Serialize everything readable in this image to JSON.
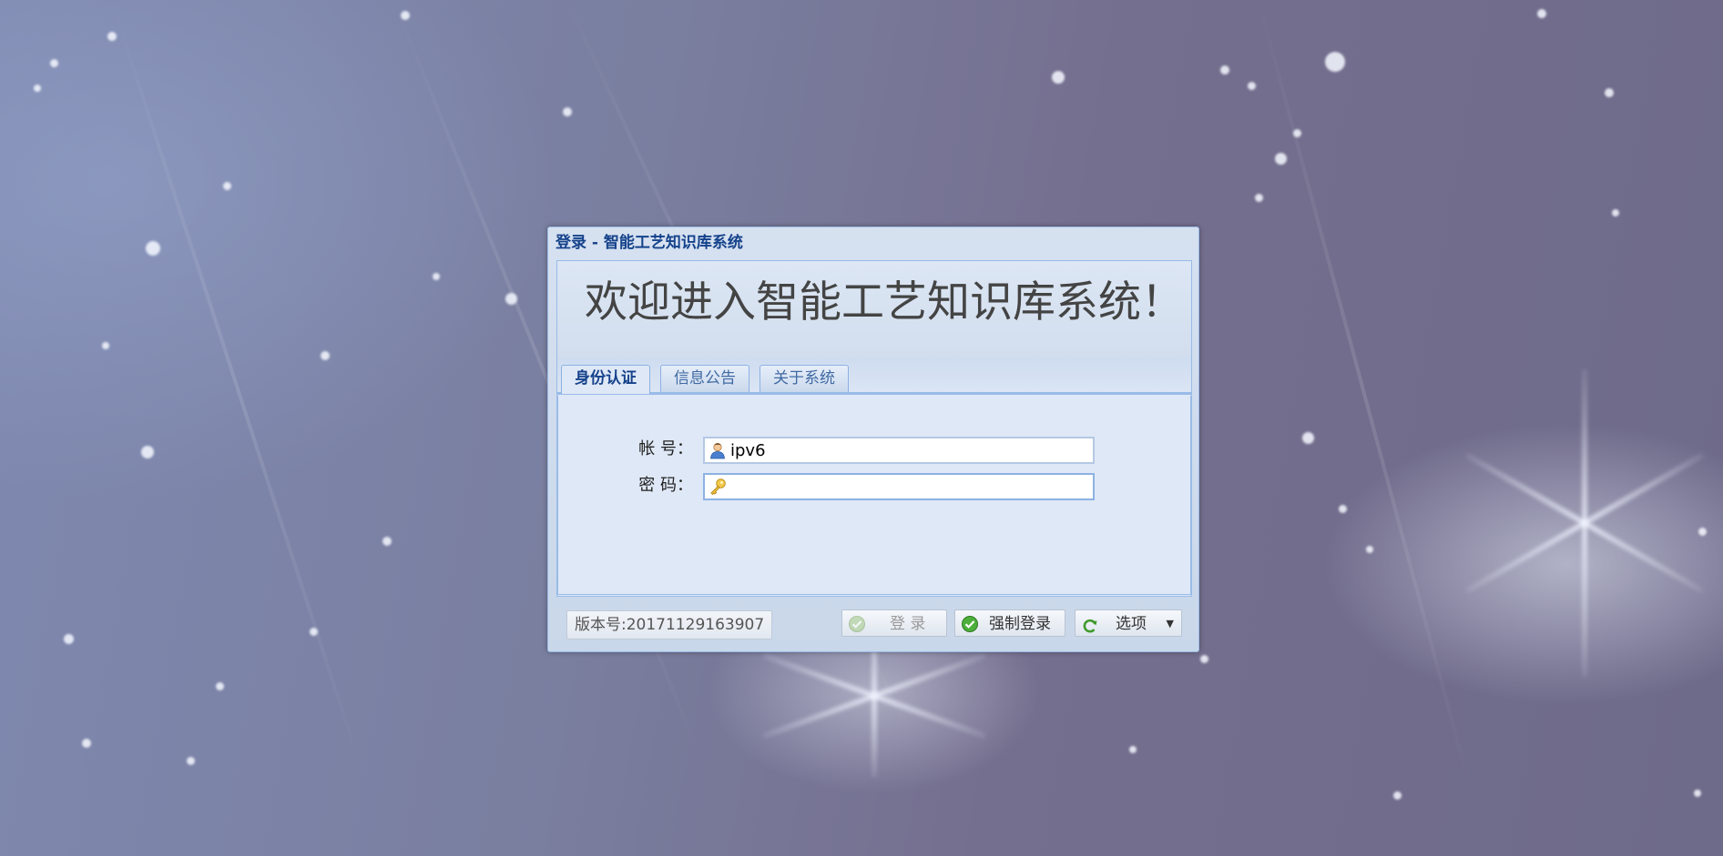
{
  "dialog": {
    "title": "登录 - 智能工艺知识库系统",
    "welcome": "欢迎进入智能工艺知识库系统！"
  },
  "tabs": [
    {
      "label": "身份认证",
      "active": true
    },
    {
      "label": "信息公告",
      "active": false
    },
    {
      "label": "关于系统",
      "active": false
    }
  ],
  "form": {
    "account_label": "帐 号：",
    "account_value": "ipv6",
    "account_icon": "user-icon",
    "password_label": "密 码：",
    "password_value": "",
    "password_icon": "key-icon"
  },
  "footer": {
    "version": "版本号:20171129163907",
    "login_label": "登 录",
    "login_icon": "check-circle-icon",
    "login_disabled": true,
    "force_login_label": "强制登录",
    "force_login_icon": "check-circle-icon",
    "options_label": "选项",
    "options_icon": "refresh-icon"
  },
  "colors": {
    "title_text": "#15428b",
    "panel_bg": "#dfe8f6",
    "border": "#99bbe8"
  }
}
